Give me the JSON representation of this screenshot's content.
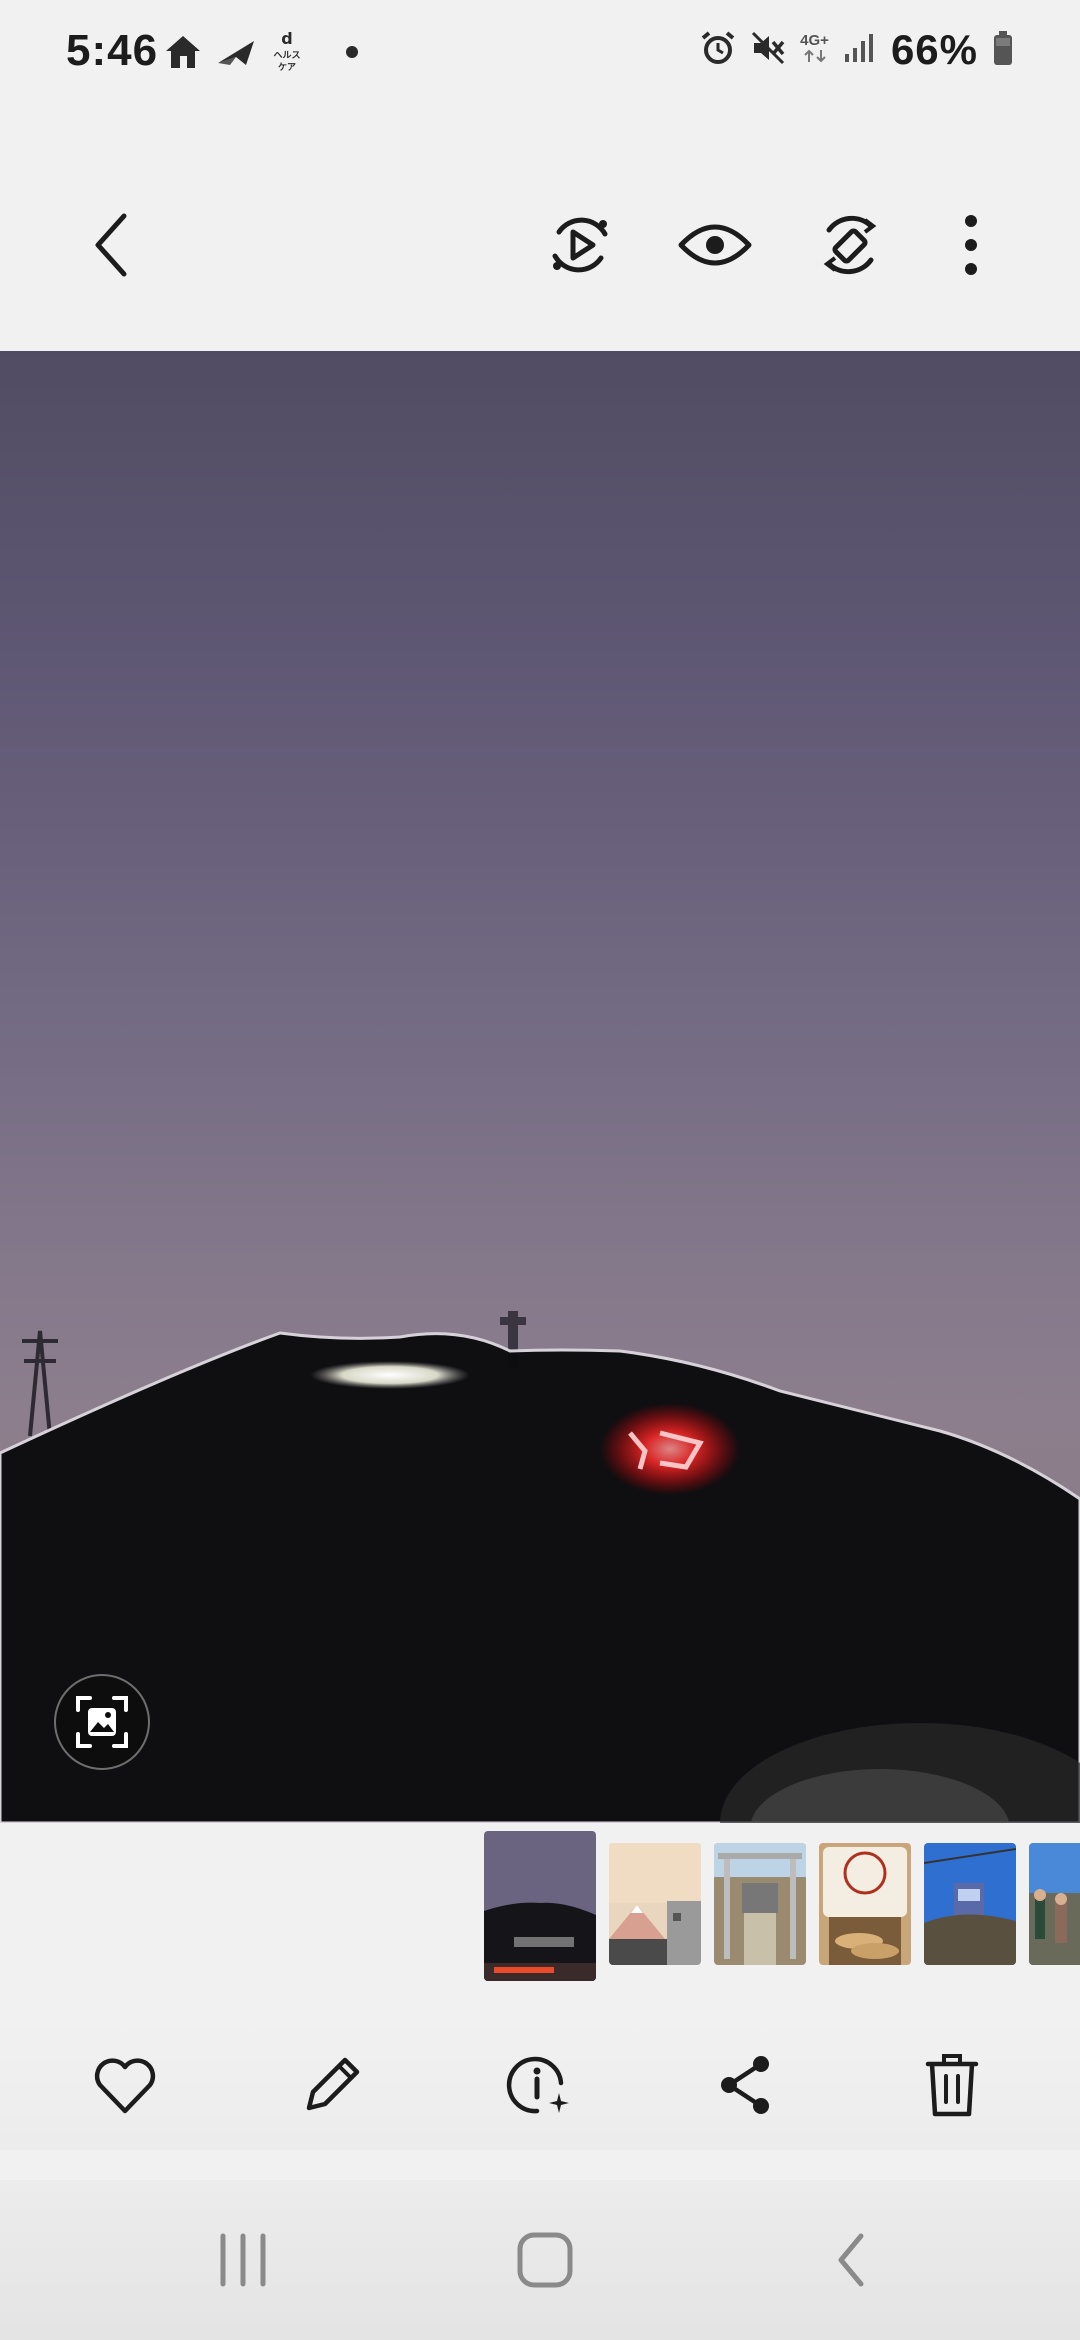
{
  "status_bar": {
    "time": "5:46",
    "left_icons": [
      "home-icon",
      "paper-plane-icon",
      "d-health-icon"
    ],
    "d_health_label": "d\nヘルスケア",
    "network_type": "4G+",
    "battery_percent": "66%",
    "right_icons": [
      "alarm-icon",
      "mute-icon",
      "signal-icon",
      "battery-icon"
    ]
  },
  "top_toolbar": {
    "icons": [
      "back-icon",
      "remaster-play-icon",
      "eye-icon",
      "rotate-icon",
      "more-options-icon"
    ]
  },
  "photo": {
    "subject": "mountain-silhouette-at-dusk",
    "sky_color_top": "#514c63",
    "sky_color_bottom": "#8c7e8c",
    "light_color": "#ff3030"
  },
  "filmstrip": {
    "thumbnails": [
      {
        "name": "thumb-dusk-mountain",
        "active": true
      },
      {
        "name": "thumb-mount-fuji",
        "active": false
      },
      {
        "name": "thumb-torii-gate",
        "active": false
      },
      {
        "name": "thumb-shrine-offerings",
        "active": false
      },
      {
        "name": "thumb-ropeway",
        "active": false
      },
      {
        "name": "thumb-hikers",
        "active": false
      }
    ]
  },
  "bottom_actions": {
    "icons": [
      "heart-icon",
      "edit-pencil-icon",
      "info-icon",
      "share-icon",
      "trash-icon"
    ]
  },
  "nav_bar": {
    "icons": [
      "recents-icon",
      "home-button-icon",
      "nav-back-icon"
    ]
  }
}
